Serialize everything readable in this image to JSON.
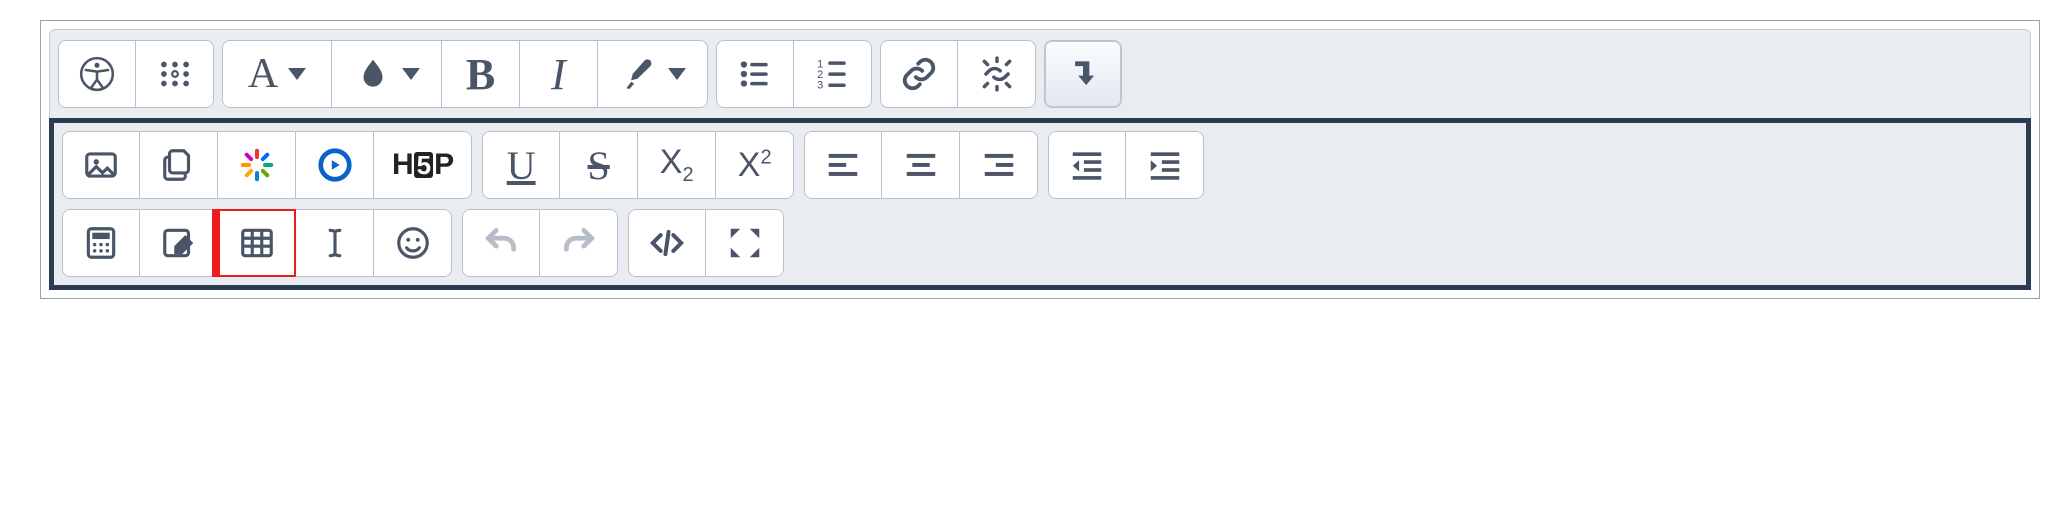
{
  "toolbar": {
    "row1": {
      "accessibility": "Accessibility checker",
      "more": "More formatting",
      "font_family_letter": "A",
      "font_color_label": "Text colour",
      "bold_letter": "B",
      "italic_letter": "I",
      "brush_label": "Clear formatting",
      "ul_label": "Bulleted list",
      "ol_label": "Numbered list",
      "link_label": "Insert link",
      "unlink_label": "Remove link",
      "toggle_label": "Toggle second toolbar row"
    },
    "row2": {
      "image_label": "Insert image",
      "files_label": "Insert file",
      "kaltura_label": "Kaltura media",
      "panopto_label": "Panopto / media",
      "h5p_label": "H5P",
      "underline_letter": "U",
      "strike_letter": "S",
      "subscript_sample": "X",
      "subscript_sub": "2",
      "superscript_sample": "X",
      "superscript_sup": "2",
      "align_left": "Align left",
      "align_center": "Align center",
      "align_right": "Align right",
      "outdent": "Decrease indent",
      "indent": "Increase indent"
    },
    "row3": {
      "equation_label": "Equation editor",
      "edit_label": "Edit",
      "table_label": "Insert table",
      "char_label": "Insert character",
      "emoji_label": "Emoji picker",
      "undo_label": "Undo",
      "redo_label": "Redo",
      "code_label": "HTML source",
      "fullscreen_label": "Fullscreen"
    }
  },
  "annotation": {
    "highlighted_button": "table"
  }
}
